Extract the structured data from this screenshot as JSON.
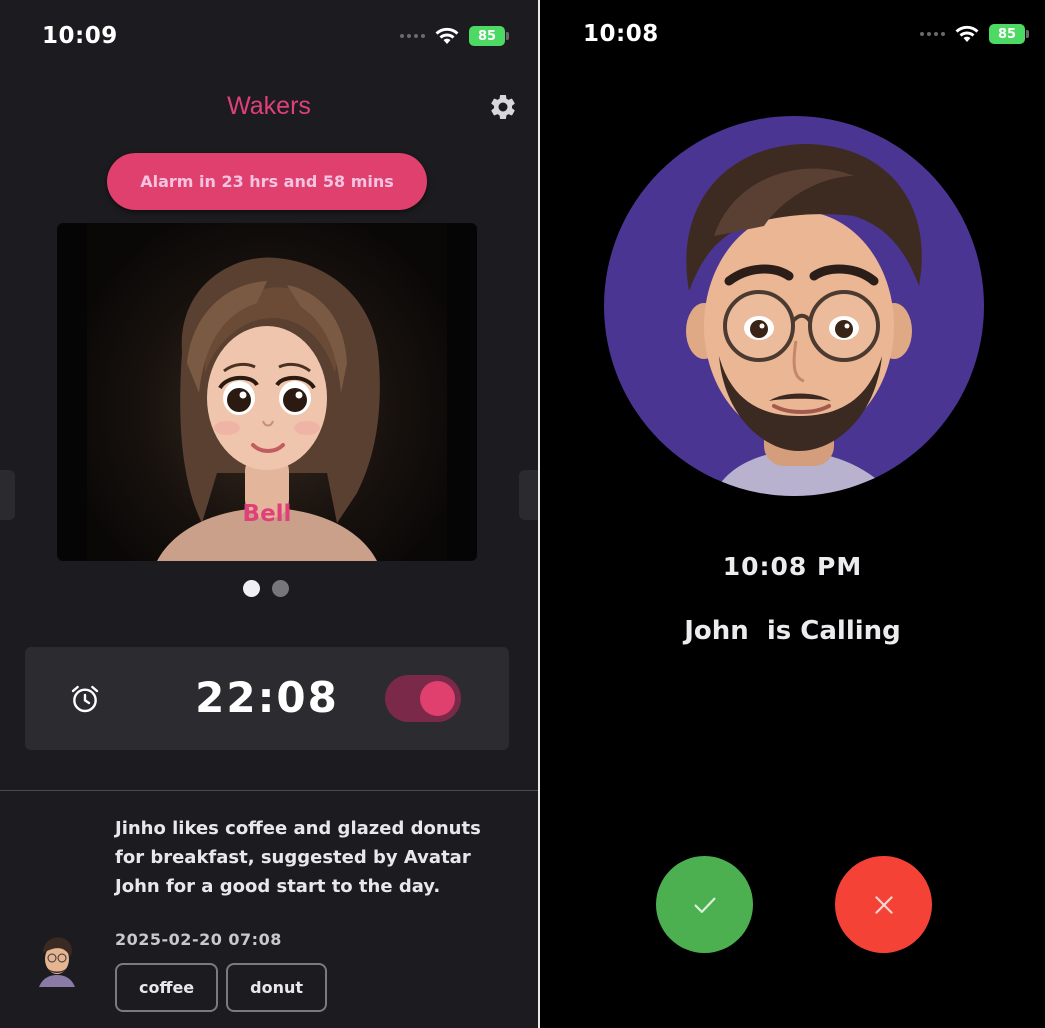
{
  "left_screen": {
    "status_bar": {
      "time": "10:09",
      "battery": "85"
    },
    "header": {
      "title": "Wakers",
      "settings_icon": "gear-icon"
    },
    "alarm_countdown": "Alarm in 23 hrs and 58 mins",
    "carousel": {
      "current_avatar_name": "Bell",
      "page_count": 2,
      "active_page": 1
    },
    "alarm": {
      "icon": "alarm-clock-icon",
      "time": "22:08",
      "enabled": true
    },
    "feed": {
      "message": "Jinho likes coffee and glazed donuts for breakfast, suggested by Avatar John for a good start to the day.",
      "date": "2025-02-20 07:08",
      "tags": [
        "coffee",
        "donut"
      ]
    }
  },
  "right_screen": {
    "status_bar": {
      "time": "10:08",
      "battery": "85"
    },
    "call": {
      "time": "10:08 PM",
      "message": "John  is Calling",
      "accept_icon": "check-icon",
      "decline_icon": "close-icon"
    }
  },
  "colors": {
    "accent": "#e0406e",
    "title": "#e0407a",
    "accept": "#4caf50",
    "decline": "#f44336",
    "caller_bg": "#4b3592",
    "battery": "#4cd964"
  }
}
